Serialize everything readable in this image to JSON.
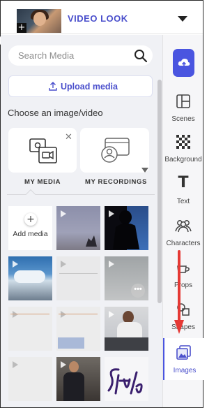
{
  "header": {
    "title": "VIDEO LOOK",
    "thumb_plus": "+"
  },
  "search": {
    "placeholder": "Search Media"
  },
  "upload": {
    "label": "Upload media"
  },
  "choose_label": "Choose an image/video",
  "sources": [
    {
      "label": "MY MEDIA"
    },
    {
      "label": "MY RECORDINGS"
    }
  ],
  "grid": {
    "add_label": "Add media",
    "more_label": "•••"
  },
  "rail": {
    "items": [
      {
        "label": "Scenes"
      },
      {
        "label": "Background"
      },
      {
        "label": "Text"
      },
      {
        "label": "Characters"
      },
      {
        "label": "Props"
      },
      {
        "label": "Shapes"
      },
      {
        "label": "Images"
      }
    ]
  },
  "colors": {
    "accent": "#4a4fcc",
    "upload_button": "#4a55e0",
    "annotation_arrow": "#e53935"
  },
  "icons": [
    "chevron-down-icon",
    "search-icon",
    "upload-icon",
    "cloud-upload-icon",
    "scenes-icon",
    "background-icon",
    "text-icon",
    "characters-icon",
    "props-icon",
    "shapes-icon",
    "images-icon",
    "close-icon",
    "play-icon",
    "more-icon"
  ]
}
